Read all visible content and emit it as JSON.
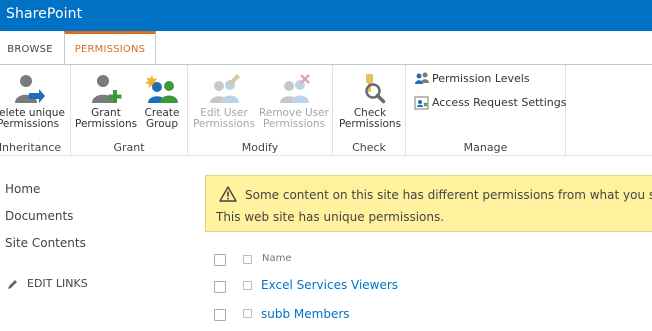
{
  "colors": {
    "brand": "#0072c6",
    "accent": "#d86e22",
    "link": "#0072c6",
    "status_bg": "#fff19d"
  },
  "suite_bar": {
    "title": "SharePoint"
  },
  "ribbon": {
    "tabs": [
      {
        "label": "BROWSE",
        "active": false
      },
      {
        "label": "PERMISSIONS",
        "active": true
      }
    ],
    "groups": [
      {
        "label": "Inheritance",
        "buttons": [
          {
            "line1": "Delete unique",
            "line2": "Permissions",
            "icon": "delete-unique-permissions-icon",
            "enabled": true
          }
        ]
      },
      {
        "label": "Grant",
        "buttons": [
          {
            "line1": "Grant",
            "line2": "Permissions",
            "icon": "grant-permissions-icon",
            "enabled": true
          },
          {
            "line1": "Create",
            "line2": "Group",
            "icon": "create-group-icon",
            "enabled": true
          }
        ]
      },
      {
        "label": "Modify",
        "buttons": [
          {
            "line1": "Edit User",
            "line2": "Permissions",
            "icon": "edit-user-permissions-icon",
            "enabled": false
          },
          {
            "line1": "Remove User",
            "line2": "Permissions",
            "icon": "remove-user-permissions-icon",
            "enabled": false
          }
        ]
      },
      {
        "label": "Check",
        "buttons": [
          {
            "line1": "Check",
            "line2": "Permissions",
            "icon": "check-permissions-icon",
            "enabled": true
          }
        ]
      },
      {
        "label": "Manage",
        "buttons": [
          {
            "label": "Permission Levels",
            "icon": "permission-levels-icon",
            "enabled": true
          },
          {
            "label": "Access Request Settings",
            "icon": "access-request-settings-icon",
            "enabled": true
          }
        ]
      }
    ]
  },
  "left_nav": {
    "items": [
      {
        "label": "Home"
      },
      {
        "label": "Documents"
      },
      {
        "label": "Site Contents"
      }
    ],
    "edit_links": "EDIT LINKS"
  },
  "status_bar": {
    "line1": "Some content on this site has different permissions from what you see",
    "line2": "This web site has unique permissions.",
    "icon": "warning-icon"
  },
  "list": {
    "column_header": "Name",
    "rows": [
      {
        "name": "Excel Services Viewers"
      },
      {
        "name": "subb Members"
      }
    ]
  }
}
